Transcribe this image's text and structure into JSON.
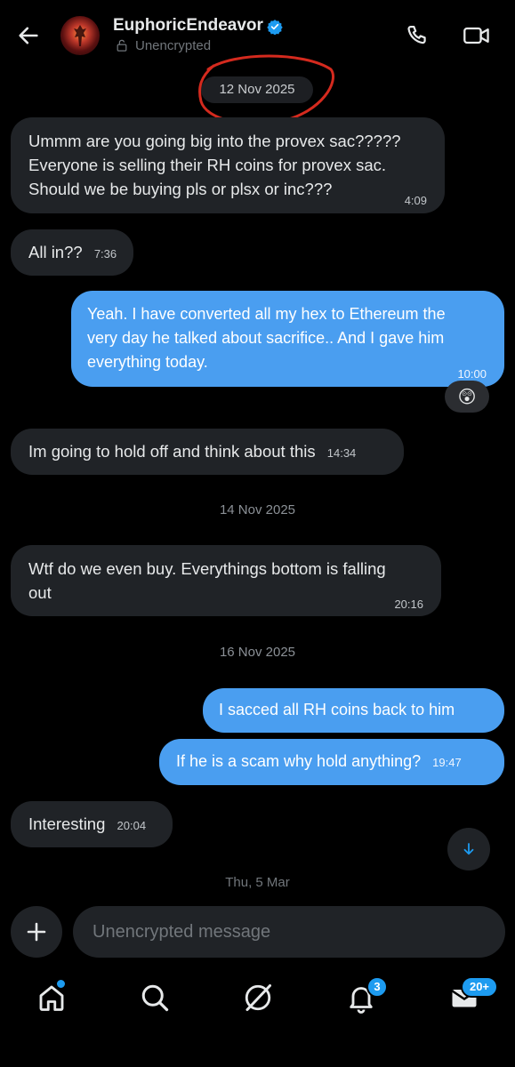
{
  "header": {
    "name": "EuphoricEndeavor",
    "encryption_label": "Unencrypted"
  },
  "dates": {
    "d1": "12 Nov 2025",
    "d2": "14 Nov 2025",
    "d3": "16 Nov 2025",
    "d4": "Thu, 5 Mar"
  },
  "messages": [
    {
      "direction": "incoming",
      "lines": [
        "Ummm are you going big into the provex sac?????",
        "Everyone is selling their RH coins for provex sac.",
        "Should we be buying pls or plsx or inc???"
      ],
      "time": "4:09"
    },
    {
      "direction": "incoming",
      "text": "All in??",
      "time": "7:36"
    },
    {
      "direction": "outgoing",
      "lines": [
        "Yeah. I have converted all my hex to Ethereum the",
        "very day he talked about sacrifice.. And I gave him",
        "everything today."
      ],
      "time": "10:00",
      "reaction": "😲"
    },
    {
      "direction": "incoming",
      "text": "Im going to hold off and think about this",
      "time": "14:34"
    },
    {
      "direction": "incoming",
      "lines": [
        "Wtf do we even buy. Everythings bottom is falling",
        "out"
      ],
      "time": "20:16"
    },
    {
      "direction": "outgoing",
      "text": "I sacced  all RH coins back to him"
    },
    {
      "direction": "outgoing",
      "text": "If he is a scam why hold anything?",
      "time": "19:47"
    },
    {
      "direction": "incoming",
      "text": "Interesting",
      "time": "20:04"
    }
  ],
  "composer": {
    "placeholder": "Unencrypted message"
  },
  "nav": {
    "notifications_badge": "3",
    "messages_badge": "20+"
  },
  "colors": {
    "background": "#000000",
    "incoming_bubble": "#202327",
    "outgoing_bubble": "#4a9ef0",
    "accent": "#1d9bf0",
    "annotation": "#d42a1e"
  },
  "icons": [
    "back-arrow-icon",
    "verified-badge-icon",
    "lock-open-icon",
    "phone-icon",
    "video-icon",
    "plus-icon",
    "arrow-down-icon",
    "home-icon",
    "search-icon",
    "grok-icon",
    "bell-icon",
    "envelope-icon"
  ]
}
